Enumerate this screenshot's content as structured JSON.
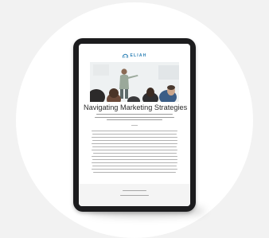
{
  "brand": {
    "name": "ELIAH",
    "accent_color": "#2a7fb5",
    "logo_icon": "arch-icon"
  },
  "article": {
    "title": "Navigating Marketing Strategies",
    "hero_image": "presenter-classroom-photo"
  },
  "colors": {
    "page_background": "#f2f2f2",
    "device_frame": "#1c1c1e",
    "footer_background": "#f4f4f4"
  }
}
